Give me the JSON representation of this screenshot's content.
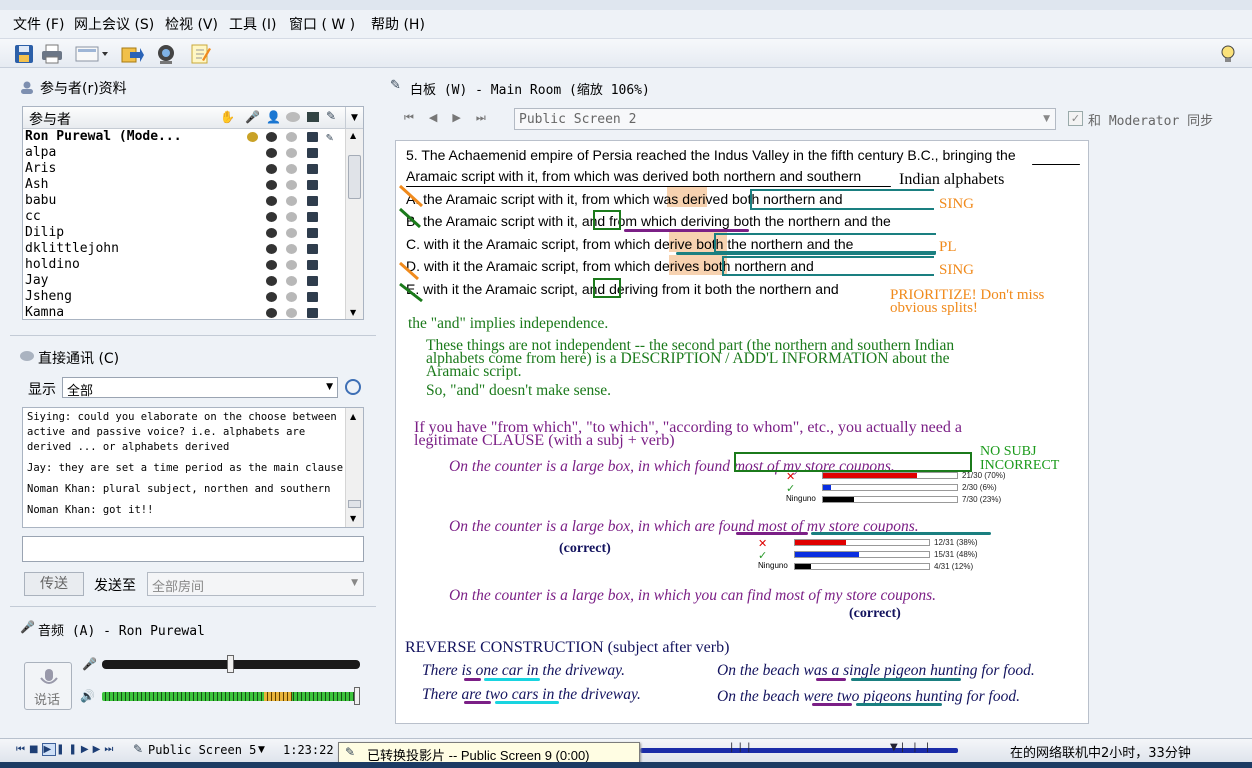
{
  "menu": [
    "文件 (F)",
    "网上会议 (S)",
    "检视 (V)",
    "工具 (I)",
    "窗口 ( W )",
    "帮助 (H)"
  ],
  "toolbar": {
    "icons": [
      "save-icon",
      "print-icon",
      "screen-icon",
      "share-icon",
      "webcam-icon",
      "notes-icon",
      "lightbulb-icon"
    ]
  },
  "participants": {
    "title": "参与者(r)资料",
    "column": "参与者",
    "people": [
      "Ron Purewal (Mode...",
      "alpa",
      "Aris",
      "Ash",
      "babu",
      "cc",
      "Dilip",
      "dklittlejohn",
      "holdino",
      "Jay",
      "Jsheng",
      "Kamna"
    ]
  },
  "chat": {
    "title": "直接通讯 (C)",
    "show_label": "显示",
    "show_value": "全部",
    "messages": [
      "Siying: could you elaborate on the choose between active and passive voice? i.e. alphabets are derived ... or alphabets derived",
      "Jay: they are set a time period as the main clause",
      "Noman Khan: plural subject, northen and southern",
      "Noman Khan: got it!!"
    ],
    "input": "",
    "send": "传送",
    "send_to_label": "发送至",
    "send_to_value": "全部房间"
  },
  "audio": {
    "title": "音频 (A) - Ron Purewal",
    "talk": "说话"
  },
  "whiteboard": {
    "title": "白板 (W) - Main Room (缩放 106%)",
    "screen": "Public Screen 2",
    "sync": "和 Moderator 同步",
    "question": [
      "5. The Achaemenid empire of Persia reached the Indus Valley in the fifth century B.C., bringing the",
      "Aramaic script with it, from which was derived both northern and southern",
      "Indian alphabets"
    ],
    "options": [
      "A. the Aramaic script with it, from which was derived both northern and",
      "B. the Aramaic script with it, and from which deriving both the northern and the",
      "C. with it the Aramaic script, from which derive both the northern and the",
      "D. with it the Aramaic script, from which derives both northern and",
      "E. with it the Aramaic script, and deriving from it both the northern and"
    ],
    "marks": [
      "SING",
      "PL",
      "SING"
    ],
    "prioritize": [
      "PRIORITIZE!  Don't miss",
      "obvious splits!"
    ],
    "green_notes": [
      "the \"and\" implies independence.",
      "These things are not independent -- the second part (the northern and southern Indian",
      "alphabets come from here) is a DESCRIPTION / ADD'L INFORMATION about the",
      "Aramaic script.",
      "So, \"and\" doesn't make sense."
    ],
    "purple_note": [
      "If you have \"from which\", \"to which\", \"according to whom\", etc.,  you actually need a",
      "legitimate CLAUSE (with a subj + verb)"
    ],
    "ex1": "On the counter is a large box, in which found most of my store coupons.",
    "ex1_note": [
      "NO SUBJ",
      "INCORRECT"
    ],
    "poll1": [
      {
        "label": "",
        "pct": 70,
        "text": "21/30 (70%)",
        "color": "#e00000"
      },
      {
        "label": "",
        "pct": 6,
        "text": "2/30 (6%)",
        "color": "#0a2ee0"
      },
      {
        "label": "Ninguno",
        "pct": 23,
        "text": "7/30 (23%)",
        "color": "#000000"
      }
    ],
    "ex2": "On the counter is a large box, in which are found most of my store coupons.",
    "correct": "(correct)",
    "poll2": [
      {
        "label": "",
        "pct": 38,
        "text": "12/31 (38%)",
        "color": "#e00000"
      },
      {
        "label": "",
        "pct": 48,
        "text": "15/31 (48%)",
        "color": "#0a2ee0"
      },
      {
        "label": "Ninguno",
        "pct": 12,
        "text": "4/31 (12%)",
        "color": "#000000"
      }
    ],
    "ex3": "On the counter is a large box, in which you can find most of my store coupons.",
    "reverse": "REVERSE CONSTRUCTION (subject after verb)",
    "rev": [
      "There is one car in the driveway.",
      "There are two cars in the driveway.",
      "On the beach was a single pigeon hunting for food.",
      "On the beach were two pigeons hunting for food."
    ]
  },
  "status": {
    "screen": "Public Screen 5",
    "time": "1:23:22",
    "toast": "已转换投影片 -- Public Screen 9 (0:00)",
    "online": "在的网络联机中2小时，33分钟"
  }
}
